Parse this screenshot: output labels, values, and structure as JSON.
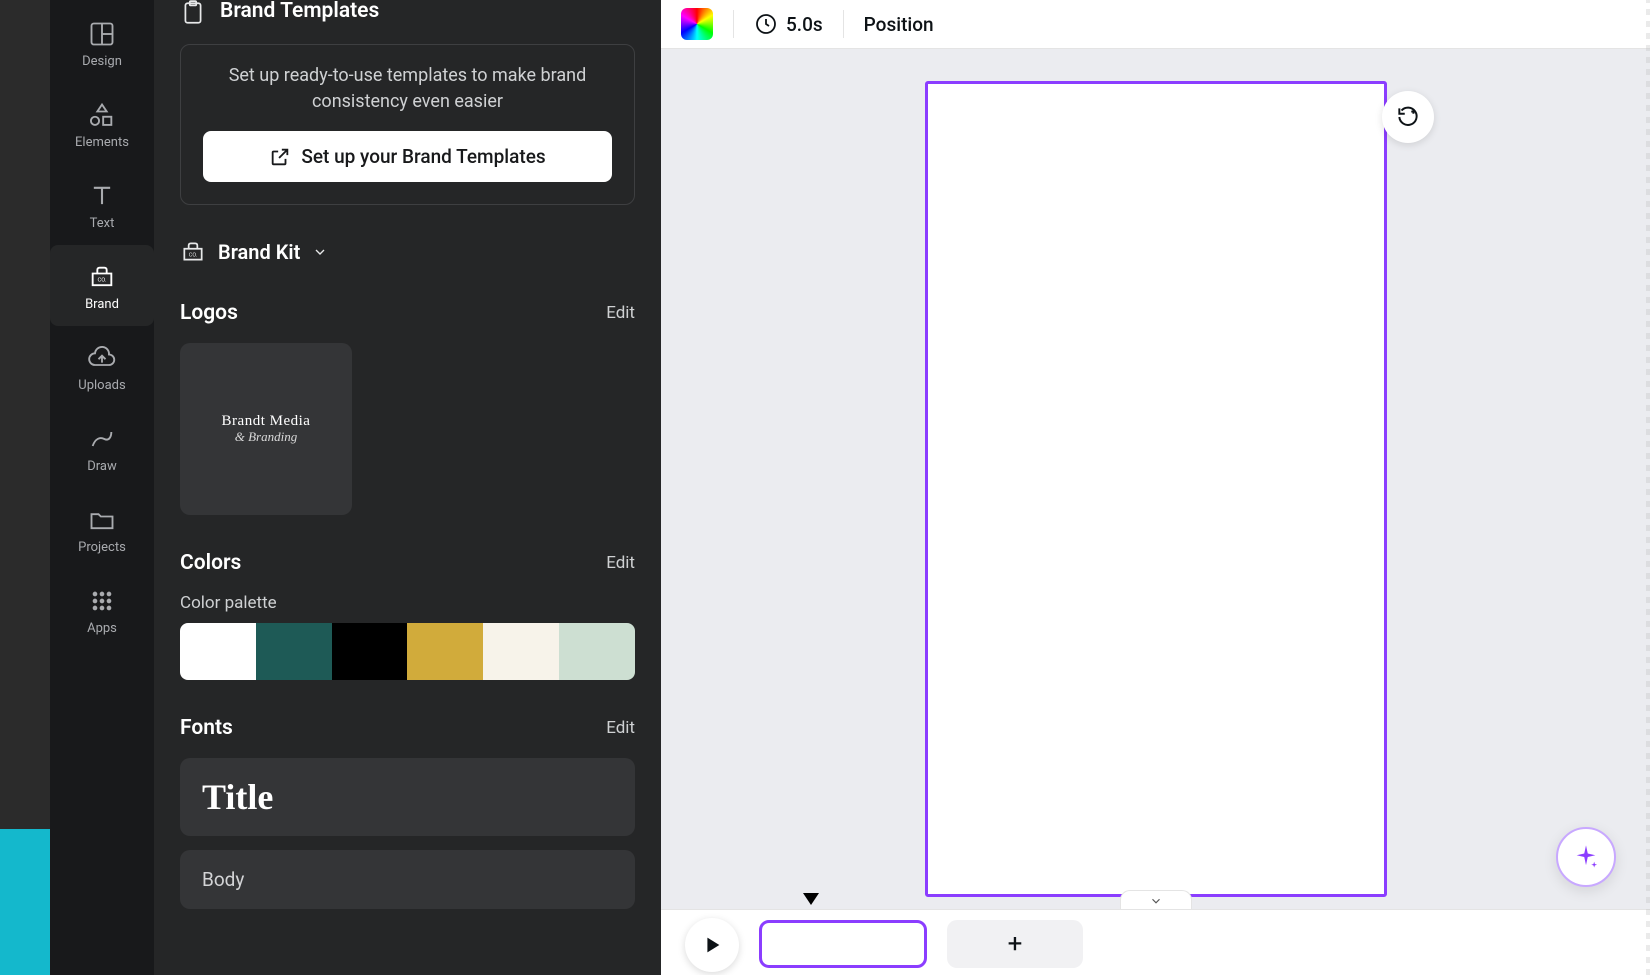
{
  "nav": {
    "items": [
      {
        "label": "Design"
      },
      {
        "label": "Elements"
      },
      {
        "label": "Text"
      },
      {
        "label": "Brand"
      },
      {
        "label": "Uploads"
      },
      {
        "label": "Draw"
      },
      {
        "label": "Projects"
      },
      {
        "label": "Apps"
      }
    ],
    "active_index": 3
  },
  "panel": {
    "header_title": "Brand Templates",
    "templates_desc": "Set up ready-to-use templates to make brand consistency even easier",
    "setup_btn": "Set up your Brand Templates",
    "kit_label": "Brand Kit",
    "logos": {
      "heading": "Logos",
      "edit": "Edit",
      "logo_line1": "Brandt Media",
      "logo_line2": "& Branding"
    },
    "colors": {
      "heading": "Colors",
      "edit": "Edit",
      "palette_label": "Color palette",
      "swatches": [
        "#ffffff",
        "#1e5a56",
        "#000000",
        "#d1ab3b",
        "#f7f3ea",
        "#cddfd2"
      ]
    },
    "fonts": {
      "heading": "Fonts",
      "edit": "Edit",
      "title_text": "Title",
      "body_text": "Body"
    }
  },
  "toolbar": {
    "duration": "5.0s",
    "position": "Position"
  },
  "accent": "#8b3dff"
}
